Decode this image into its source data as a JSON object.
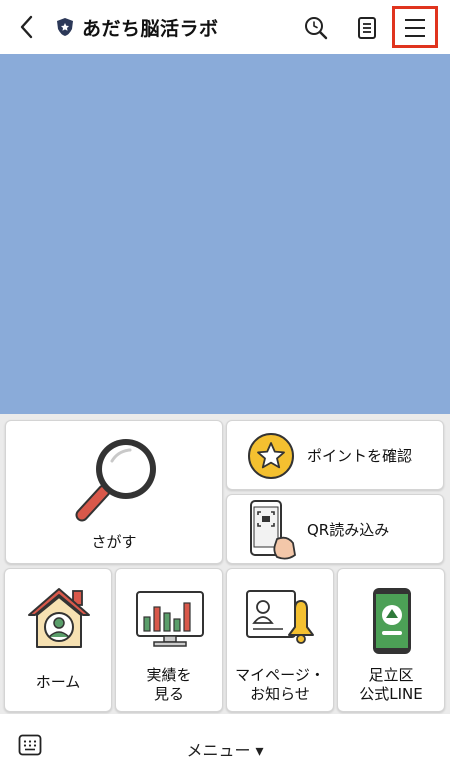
{
  "header": {
    "title": "あだち脳活ラボ",
    "icons": [
      "back-icon",
      "shield-icon",
      "search-icon",
      "notes-icon",
      "hamburger-menu-icon"
    ]
  },
  "colors": {
    "banner": "#8aabd9",
    "highlight": "#e0341e",
    "menu_bg": "#ebebeb"
  },
  "rich_menu": {
    "search": {
      "label": "さがす",
      "icon": "magnifier-icon"
    },
    "points": {
      "label": "ポイントを確認",
      "icon": "star-icon"
    },
    "qr": {
      "label": "QR読み込み",
      "icon": "qr-phone-icon"
    },
    "home": {
      "label": "ホーム",
      "icon": "house-icon"
    },
    "results": {
      "label_line1": "実績を",
      "label_line2": "見る",
      "icon": "chart-monitor-icon"
    },
    "mypage": {
      "label_line1": "マイページ・",
      "label_line2": "お知らせ",
      "icon": "profile-bell-icon"
    },
    "line": {
      "label_line1": "足立区",
      "label_line2": "公式LINE",
      "icon": "line-phone-icon"
    }
  },
  "footer": {
    "label": "メニュー ▾",
    "icon": "keyboard-icon"
  }
}
